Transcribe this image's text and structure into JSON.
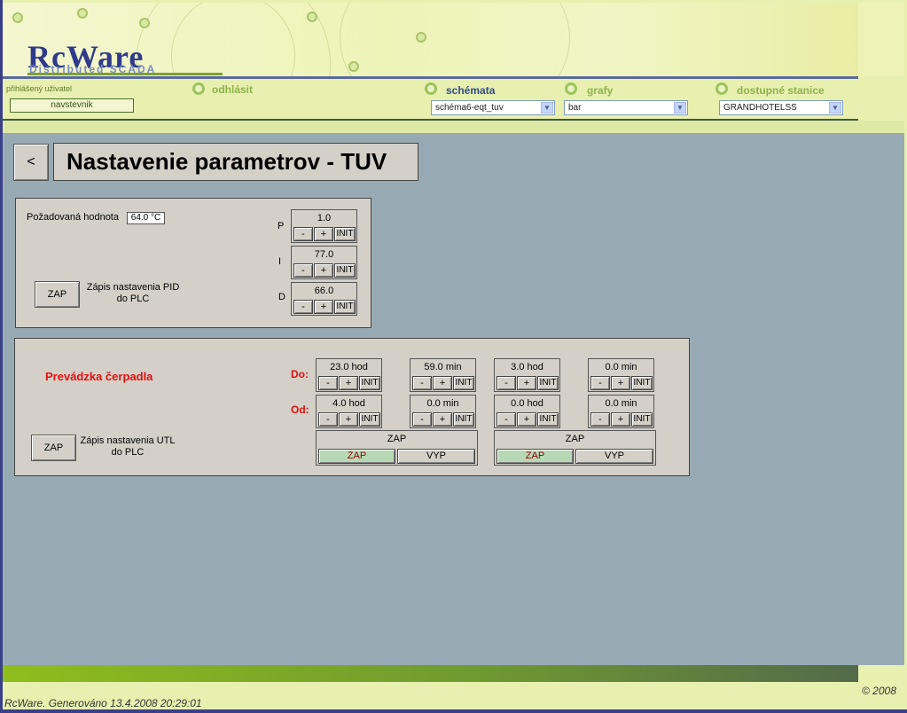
{
  "brand": {
    "logo": "RcWare",
    "tagline": "Distributed SCADA"
  },
  "nav": {
    "user_label": "přihlášený uživatel",
    "user_name": "navstevnik",
    "logout": "odhlásit",
    "schemes_label": "schémata",
    "schemes_value": "schéma6-eqt_tuv",
    "graphs_label": "grafy",
    "graphs_value": "bar",
    "stations_label": "dostupné stanice",
    "stations_value": "GRANDHOTELSS"
  },
  "page": {
    "back": "<",
    "title": "Nastavenie parametrov - TUV"
  },
  "pid": {
    "setpoint_label": "Požadovaná hodnota",
    "setpoint_value": "64.0 °C",
    "p_label": "P",
    "p_value": "1.0",
    "i_label": "I",
    "i_value": "77.0",
    "d_label": "D",
    "d_value": "66.0",
    "write_button": "ZAP",
    "write_label_1": "Zápis nastavenia PID",
    "write_label_2": "do PLC"
  },
  "spinner": {
    "minus": "-",
    "plus": "+",
    "init": "INIT"
  },
  "pump": {
    "title": "Prevádzka čerpadla",
    "do_label": "Do:",
    "od_label": "Od:",
    "do_values": [
      "23.0 hod",
      "59.0 min",
      "3.0 hod",
      "0.0 min"
    ],
    "od_values": [
      "4.0 hod",
      "0.0 min",
      "0.0 hod",
      "0.0 min"
    ],
    "toggles": [
      {
        "title": "ZAP",
        "on": "ZAP",
        "off": "VYP"
      },
      {
        "title": "ZAP",
        "on": "ZAP",
        "off": "VYP"
      }
    ],
    "write_button": "ZAP",
    "write_label_1": "Zápis nastavenia UTL",
    "write_label_2": "do PLC"
  },
  "footer": {
    "copyright": "© 2008",
    "generated": "RcWare. Generováno 13.4.2008 20:29:01"
  },
  "colors": {
    "accent_green": "#8fbd1c",
    "workspace": "#97aab3",
    "alert_red": "#e01010"
  }
}
